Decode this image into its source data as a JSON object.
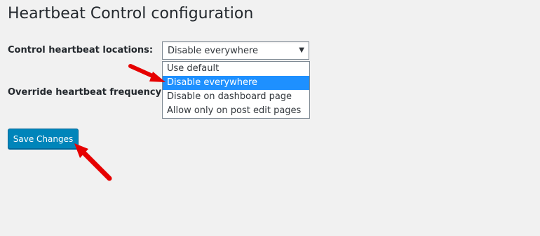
{
  "page": {
    "title": "Heartbeat Control configuration"
  },
  "form": {
    "locations_label": "Control heartbeat locations:",
    "frequency_label": "Override heartbeat frequency:",
    "locations_select": {
      "selected_value": "Disable everywhere",
      "options": [
        "Use default",
        "Disable everywhere",
        "Disable on dashboard page",
        "Allow only on post edit pages"
      ],
      "highlighted_index": 1
    },
    "save_label": "Save Changes"
  },
  "colors": {
    "background": "#f1f1f1",
    "button_primary": "#0085ba",
    "option_highlight": "#1e90ff",
    "annotation_arrow": "#e60000"
  },
  "icons": {
    "select_arrow": "caret-down-icon"
  }
}
